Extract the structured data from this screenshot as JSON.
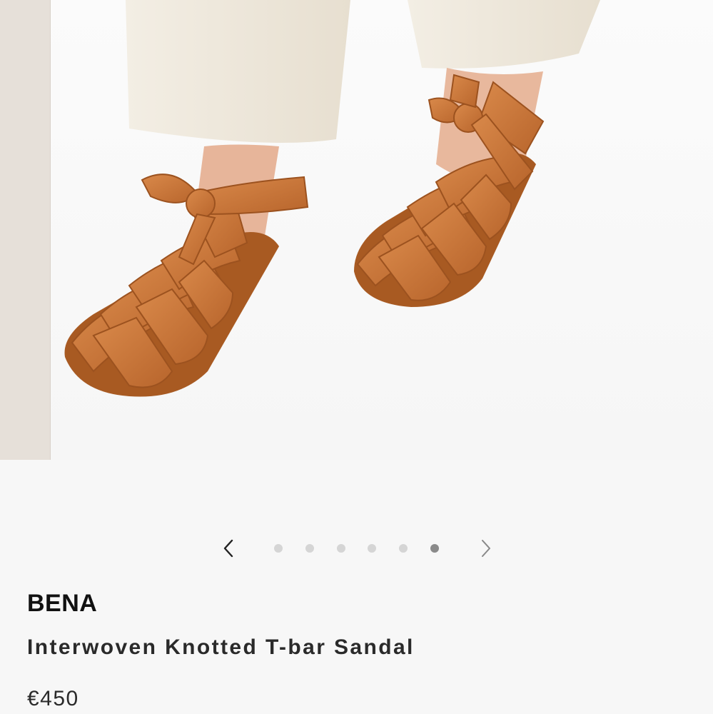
{
  "product": {
    "brand": "BENA",
    "name": "Interwoven Knotted T-bar Sandal",
    "price": "€450"
  },
  "carousel": {
    "total_slides": 6,
    "active_slide": 6,
    "prev_icon": "chevron-left-icon",
    "next_icon": "chevron-right-icon"
  },
  "colors": {
    "leather": "#c8773a",
    "trousers": "#efe9dd",
    "background": "#f7f7f7",
    "active_dot": "#8a8a8a",
    "inactive_dot": "#d5d5d5"
  }
}
